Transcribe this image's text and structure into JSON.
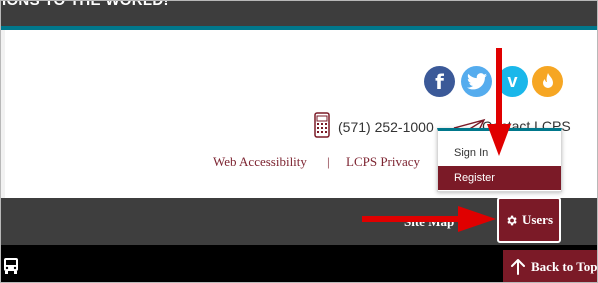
{
  "header": {
    "tagline": "IONS TO THE WORLD!"
  },
  "colors": {
    "maroon": "#7b1a27",
    "teal": "#00778b",
    "facebook": "#3b5998",
    "twitter": "#55acee",
    "vimeo": "#1ab7ea",
    "fire": "#f6a623",
    "annotation_arrow": "#e00000"
  },
  "social": [
    {
      "name": "facebook-icon",
      "glyph": "f"
    },
    {
      "name": "twitter-icon",
      "glyph": ""
    },
    {
      "name": "vimeo-icon",
      "glyph": "v"
    },
    {
      "name": "flame-icon",
      "glyph": ""
    }
  ],
  "contact": {
    "phone": "(571) 252-1000",
    "contact_label": "Contact LCPS"
  },
  "footer": {
    "accessibility": "Web Accessibility",
    "separator": "|",
    "privacy": "LCPS Privacy"
  },
  "bottom_bar": {
    "site_map": "Site Map",
    "users": "Users"
  },
  "users_menu": {
    "items": [
      "Sign In",
      "Register"
    ]
  },
  "back_to_top": "Back to Top"
}
